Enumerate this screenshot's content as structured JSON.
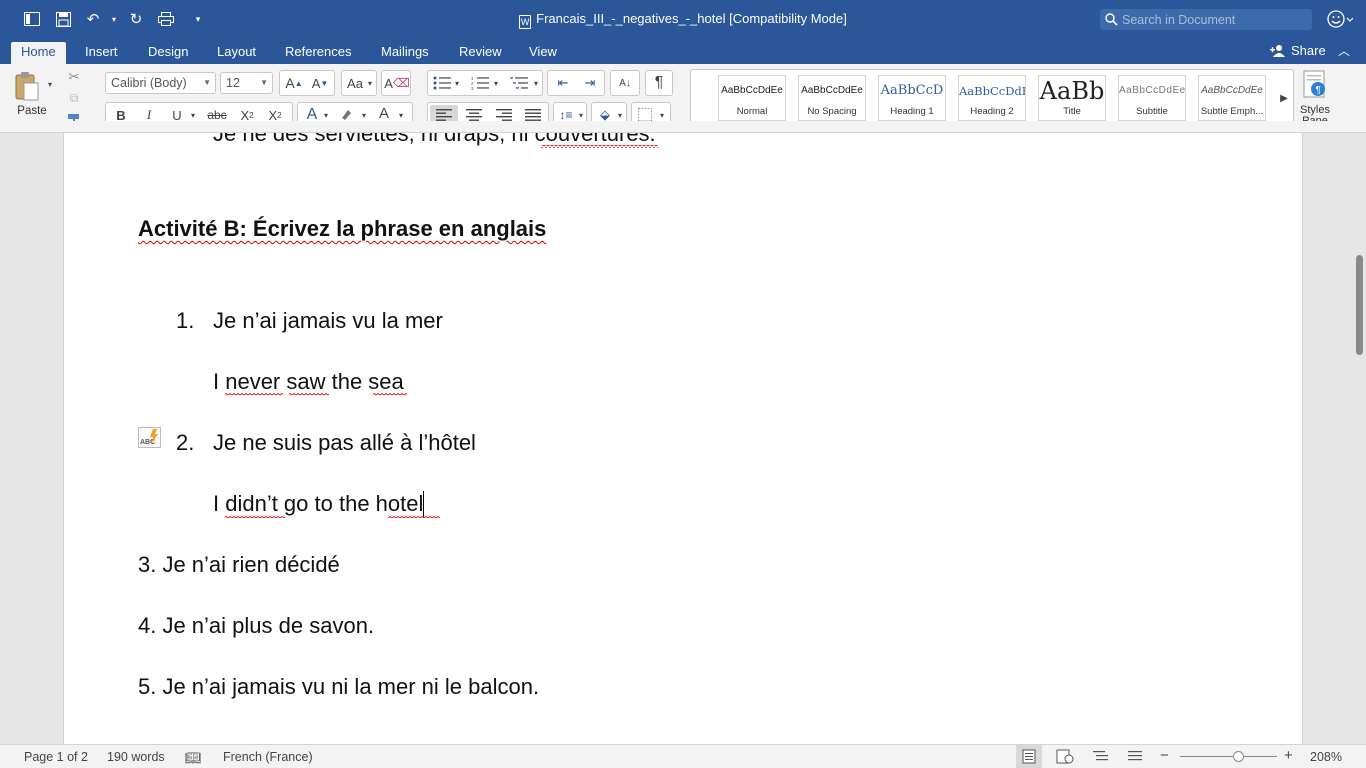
{
  "window": {
    "doc_title": "Francais_III_-_negatives_-_hotel [Compatibility Mode]",
    "search_placeholder": "Search in Document"
  },
  "tabs": [
    {
      "label": "Home",
      "active": true
    },
    {
      "label": "Insert"
    },
    {
      "label": "Design"
    },
    {
      "label": "Layout"
    },
    {
      "label": "References"
    },
    {
      "label": "Mailings"
    },
    {
      "label": "Review"
    },
    {
      "label": "View"
    }
  ],
  "share_label": "Share",
  "ribbon": {
    "paste_label": "Paste",
    "font_name": "Calibri (Body)",
    "font_size": "12",
    "styles_pane_label": "Styles\nPane",
    "styles": [
      {
        "sample": "AaBbCcDdEe",
        "name": "Normal"
      },
      {
        "sample": "AaBbCcDdEe",
        "name": "No Spacing"
      },
      {
        "sample": "AaBbCcD",
        "name": "Heading 1"
      },
      {
        "sample": "AaBbCcDdE",
        "name": "Heading 2"
      },
      {
        "sample": "AaBb",
        "name": "Title"
      },
      {
        "sample": "AaBbCcDdEe",
        "name": "Subtitle"
      },
      {
        "sample": "AaBbCcDdEe",
        "name": "Subtle Emph..."
      }
    ]
  },
  "document": {
    "partial_top_line": "Je ne des serviettes, ni draps, ni couvertures.",
    "heading": "Activité B: Écrivez la phrase en anglais",
    "item1_num": "1.",
    "item1_fr": "Je n’ai jamais vu la mer",
    "item1_en": "I never saw the sea",
    "item2_num": "2.",
    "item2_fr": "Je ne suis pas allé à l’hôtel",
    "item2_en": "I didn’t go to the hotel",
    "item3": "3. Je n’ai rien décidé",
    "item4": "4. Je n’ai plus de savon.",
    "item5": "5. Je n’ai jamais vu ni la mer ni le balcon."
  },
  "status": {
    "page": "Page 1 of 2",
    "words": "190 words",
    "language": "French (France)",
    "zoom": "208%"
  }
}
